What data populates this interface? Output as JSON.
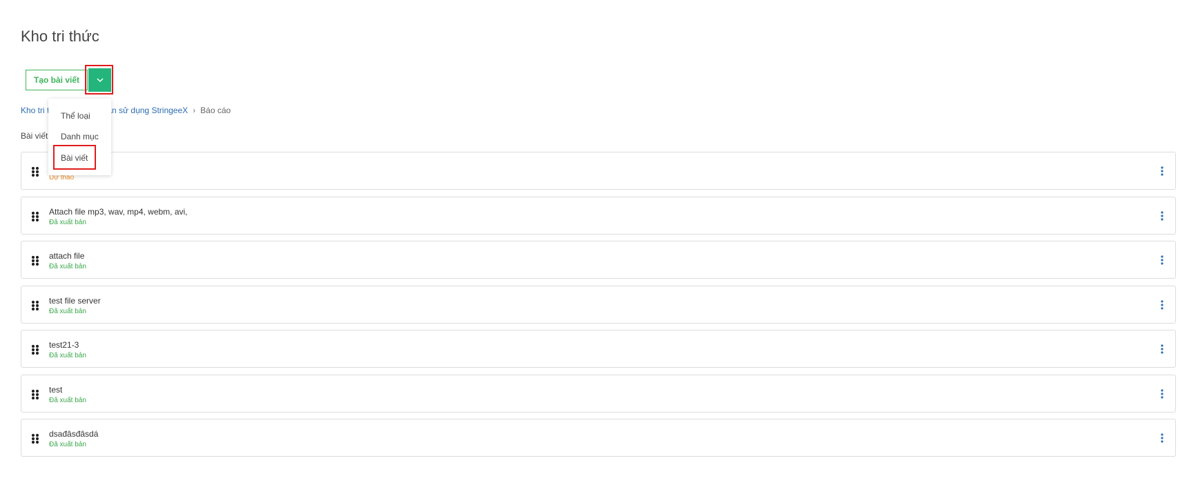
{
  "page": {
    "title": "Kho tri thức"
  },
  "toolbar": {
    "create_label": "Tạo bài viết",
    "toggle_icon": "chevron-down-icon",
    "accent": "#23b57c"
  },
  "breadcrumb": {
    "items": [
      {
        "label": "Kho tri thức",
        "visible_text": "Kho tri t"
      },
      {
        "label": "Hướng dẫn sử dụng StringeeX",
        "visible_text": "ẫn sử dụng StringeeX"
      },
      {
        "label": "Báo cáo"
      }
    ]
  },
  "section": {
    "label": "Bài viết"
  },
  "dropdown": {
    "items": [
      {
        "label": "Thể loại"
      },
      {
        "label": "Danh mục"
      },
      {
        "label": "Bài viết"
      }
    ]
  },
  "status_colors": {
    "draft": "#f08a24",
    "published": "#3aa84a"
  },
  "articles": [
    {
      "title": "",
      "status": "Dự thảo",
      "status_type": "draft"
    },
    {
      "title": "Attach file mp3, wav, mp4, webm, avi,",
      "status": "Đã xuất bản",
      "status_type": "published"
    },
    {
      "title": "attach file",
      "status": "Đã xuất bản",
      "status_type": "published"
    },
    {
      "title": "test file server",
      "status": "Đã xuất bản",
      "status_type": "published"
    },
    {
      "title": "test21-3",
      "status": "Đã xuất bản",
      "status_type": "published"
    },
    {
      "title": "test",
      "status": "Đã xuất bản",
      "status_type": "published"
    },
    {
      "title": "dsađâsđâsdá",
      "status": "Đã xuất bản",
      "status_type": "published"
    }
  ]
}
